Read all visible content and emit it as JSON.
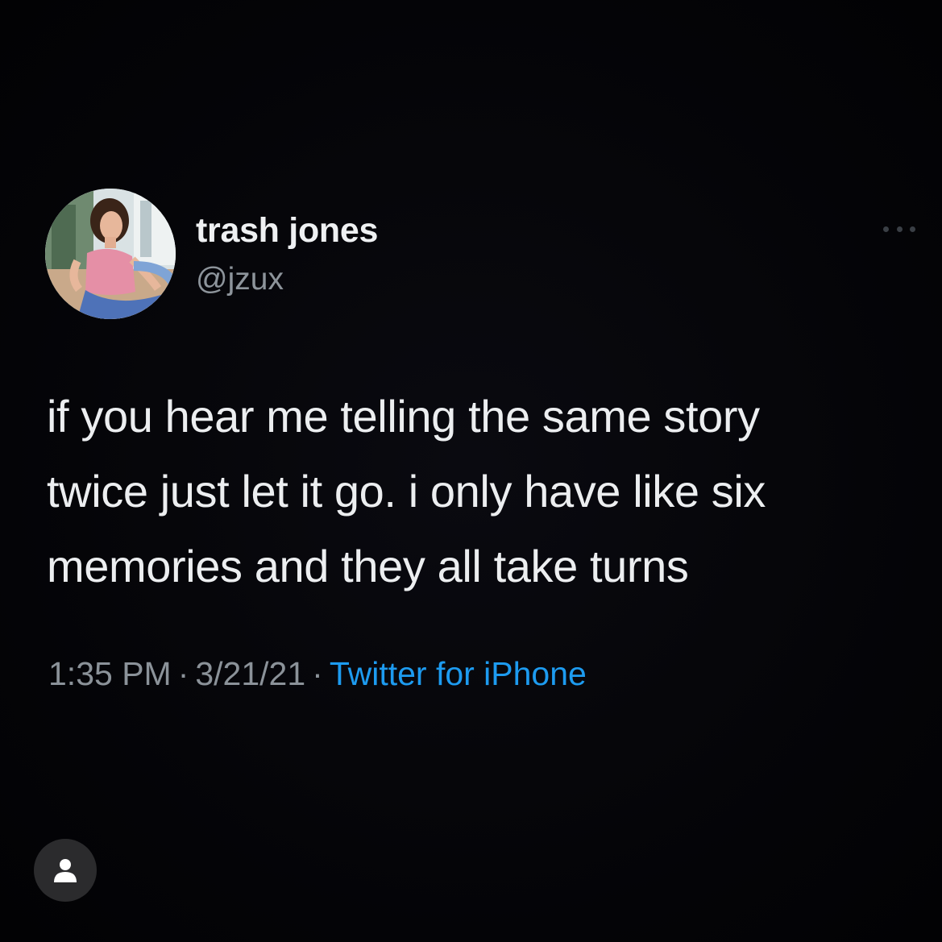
{
  "tweet": {
    "author": {
      "display_name": "trash jones",
      "handle": "@jzux",
      "avatar_icon": "profile-photo"
    },
    "text_lines": [
      "if you hear me telling the same story",
      "twice just let it go. i only have like six",
      "memories and they all take turns"
    ],
    "meta": {
      "time": "1:35 PM",
      "date": "3/21/21",
      "separator": "·",
      "source": "Twitter for iPhone"
    },
    "more_icon": "more-horizontal-icon"
  },
  "overlay": {
    "profile_button_icon": "user-icon"
  },
  "colors": {
    "background": "#050509",
    "text": "#eceef0",
    "secondary_text": "#8b9299",
    "link": "#1d9bf0"
  }
}
